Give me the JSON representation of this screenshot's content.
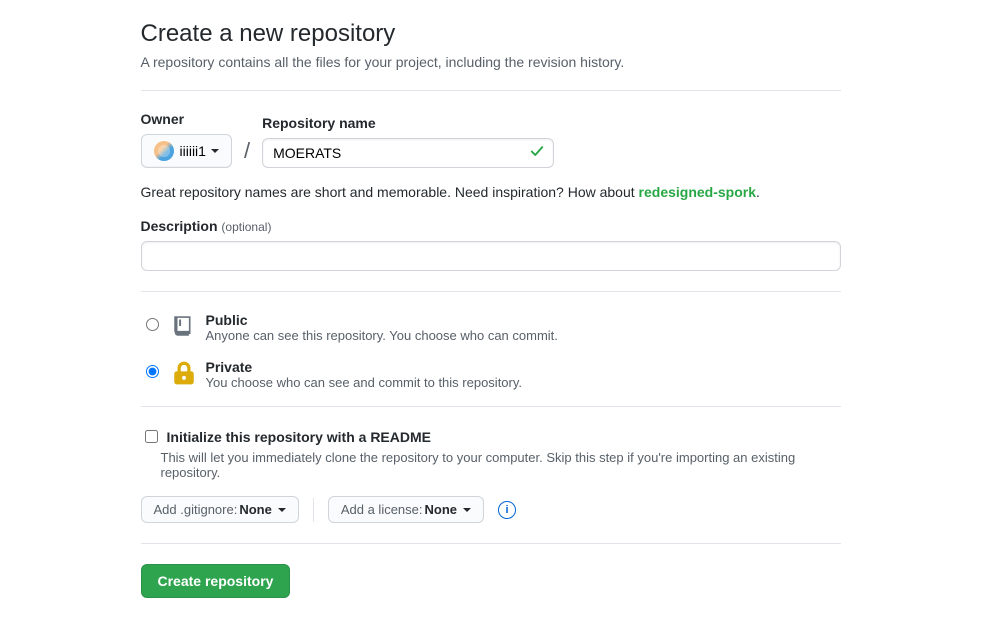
{
  "header": {
    "title": "Create a new repository",
    "subtitle": "A repository contains all the files for your project, including the revision history."
  },
  "owner": {
    "label": "Owner",
    "username": "iiiiii1"
  },
  "repo_name": {
    "label": "Repository name",
    "value": "MOERATS"
  },
  "name_hint": {
    "prefix": "Great repository names are short and memorable. Need inspiration? How about ",
    "suggestion": "redesigned-spork",
    "suffix": "."
  },
  "description": {
    "label": "Description",
    "optional_text": "(optional)",
    "value": ""
  },
  "visibility": {
    "public": {
      "title": "Public",
      "desc": "Anyone can see this repository. You choose who can commit.",
      "checked": false
    },
    "private": {
      "title": "Private",
      "desc": "You choose who can see and commit to this repository.",
      "checked": true
    }
  },
  "readme": {
    "label": "Initialize this repository with a README",
    "desc": "This will let you immediately clone the repository to your computer. Skip this step if you're importing an existing repository.",
    "checked": false
  },
  "gitignore": {
    "prefix": "Add .gitignore: ",
    "value": "None"
  },
  "license": {
    "prefix": "Add a license: ",
    "value": "None"
  },
  "create_button": "Create repository"
}
